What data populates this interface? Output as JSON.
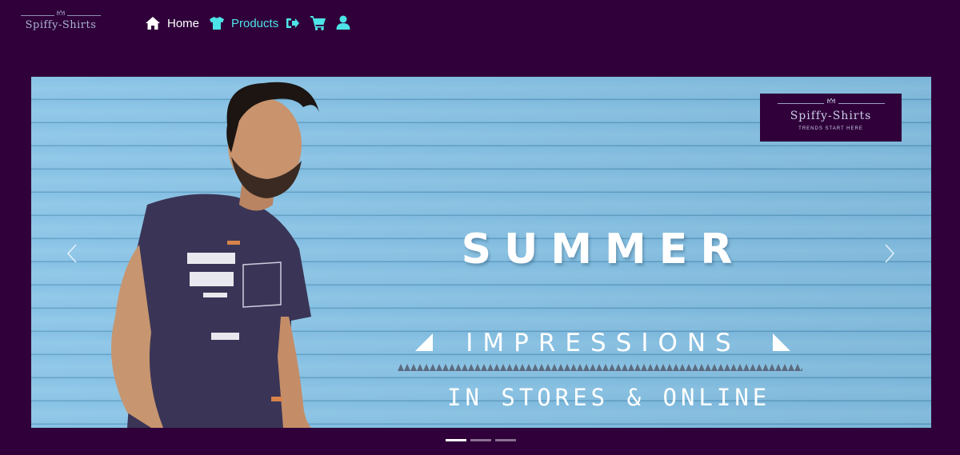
{
  "brand": {
    "name": "Spiffy-Shirts"
  },
  "nav": {
    "home_label": "Home",
    "products_label": "Products",
    "icons": [
      "home-icon",
      "shirt-icon",
      "logout-icon",
      "cart-icon",
      "user-icon"
    ]
  },
  "carousel": {
    "slide": {
      "logo_name": "Spiffy-Shirts",
      "logo_tagline": "TRENDS START HERE",
      "headline": "SUMMER",
      "subheadline": "IMPRESSIONS",
      "tagline": "IN STORES & ONLINE"
    },
    "slide_count": 3,
    "active_slide": 1
  },
  "colors": {
    "background": "#2f0039",
    "accent": "#4de4e8",
    "banner_blue": "#86c1e5"
  }
}
